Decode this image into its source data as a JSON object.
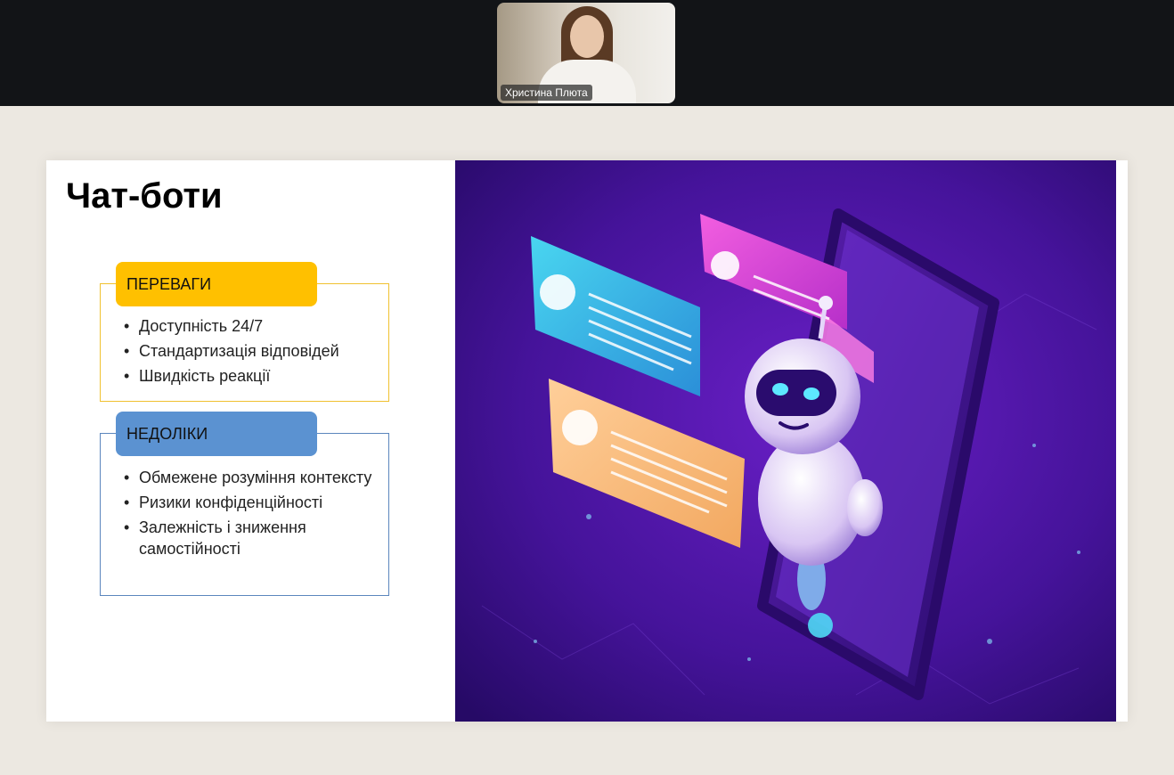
{
  "meeting": {
    "participant_name": "Христина Плюта"
  },
  "slide": {
    "title": "Чат-боти",
    "pros": {
      "header": "ПЕРЕВАГИ",
      "color": "#ffc000",
      "items": [
        "Доступність 24/7",
        "Стандартизація відповідей",
        "Швидкість реакції"
      ]
    },
    "cons": {
      "header": "НЕДОЛІКИ",
      "color": "#5b92d1",
      "items": [
        "Обмежене розуміння контексту",
        "Ризики конфіденційності",
        "Залежність і зниження самостійності"
      ]
    },
    "illustration": {
      "icon": "chatbot-robot-phone-illustration",
      "background_color": "#3c0f8a"
    }
  }
}
